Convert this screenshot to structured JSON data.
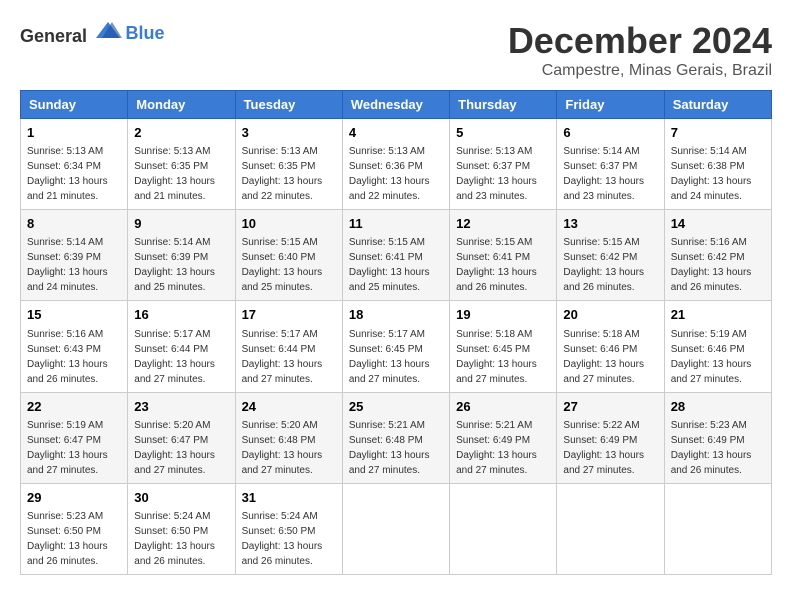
{
  "header": {
    "logo_general": "General",
    "logo_blue": "Blue",
    "month_title": "December 2024",
    "location": "Campestre, Minas Gerais, Brazil"
  },
  "calendar": {
    "days_of_week": [
      "Sunday",
      "Monday",
      "Tuesday",
      "Wednesday",
      "Thursday",
      "Friday",
      "Saturday"
    ],
    "weeks": [
      [
        {
          "day": "1",
          "sunrise": "5:13 AM",
          "sunset": "6:34 PM",
          "daylight": "13 hours and 21 minutes."
        },
        {
          "day": "2",
          "sunrise": "5:13 AM",
          "sunset": "6:35 PM",
          "daylight": "13 hours and 21 minutes."
        },
        {
          "day": "3",
          "sunrise": "5:13 AM",
          "sunset": "6:35 PM",
          "daylight": "13 hours and 22 minutes."
        },
        {
          "day": "4",
          "sunrise": "5:13 AM",
          "sunset": "6:36 PM",
          "daylight": "13 hours and 22 minutes."
        },
        {
          "day": "5",
          "sunrise": "5:13 AM",
          "sunset": "6:37 PM",
          "daylight": "13 hours and 23 minutes."
        },
        {
          "day": "6",
          "sunrise": "5:14 AM",
          "sunset": "6:37 PM",
          "daylight": "13 hours and 23 minutes."
        },
        {
          "day": "7",
          "sunrise": "5:14 AM",
          "sunset": "6:38 PM",
          "daylight": "13 hours and 24 minutes."
        }
      ],
      [
        {
          "day": "8",
          "sunrise": "5:14 AM",
          "sunset": "6:39 PM",
          "daylight": "13 hours and 24 minutes."
        },
        {
          "day": "9",
          "sunrise": "5:14 AM",
          "sunset": "6:39 PM",
          "daylight": "13 hours and 25 minutes."
        },
        {
          "day": "10",
          "sunrise": "5:15 AM",
          "sunset": "6:40 PM",
          "daylight": "13 hours and 25 minutes."
        },
        {
          "day": "11",
          "sunrise": "5:15 AM",
          "sunset": "6:41 PM",
          "daylight": "13 hours and 25 minutes."
        },
        {
          "day": "12",
          "sunrise": "5:15 AM",
          "sunset": "6:41 PM",
          "daylight": "13 hours and 26 minutes."
        },
        {
          "day": "13",
          "sunrise": "5:15 AM",
          "sunset": "6:42 PM",
          "daylight": "13 hours and 26 minutes."
        },
        {
          "day": "14",
          "sunrise": "5:16 AM",
          "sunset": "6:42 PM",
          "daylight": "13 hours and 26 minutes."
        }
      ],
      [
        {
          "day": "15",
          "sunrise": "5:16 AM",
          "sunset": "6:43 PM",
          "daylight": "13 hours and 26 minutes."
        },
        {
          "day": "16",
          "sunrise": "5:17 AM",
          "sunset": "6:44 PM",
          "daylight": "13 hours and 27 minutes."
        },
        {
          "day": "17",
          "sunrise": "5:17 AM",
          "sunset": "6:44 PM",
          "daylight": "13 hours and 27 minutes."
        },
        {
          "day": "18",
          "sunrise": "5:17 AM",
          "sunset": "6:45 PM",
          "daylight": "13 hours and 27 minutes."
        },
        {
          "day": "19",
          "sunrise": "5:18 AM",
          "sunset": "6:45 PM",
          "daylight": "13 hours and 27 minutes."
        },
        {
          "day": "20",
          "sunrise": "5:18 AM",
          "sunset": "6:46 PM",
          "daylight": "13 hours and 27 minutes."
        },
        {
          "day": "21",
          "sunrise": "5:19 AM",
          "sunset": "6:46 PM",
          "daylight": "13 hours and 27 minutes."
        }
      ],
      [
        {
          "day": "22",
          "sunrise": "5:19 AM",
          "sunset": "6:47 PM",
          "daylight": "13 hours and 27 minutes."
        },
        {
          "day": "23",
          "sunrise": "5:20 AM",
          "sunset": "6:47 PM",
          "daylight": "13 hours and 27 minutes."
        },
        {
          "day": "24",
          "sunrise": "5:20 AM",
          "sunset": "6:48 PM",
          "daylight": "13 hours and 27 minutes."
        },
        {
          "day": "25",
          "sunrise": "5:21 AM",
          "sunset": "6:48 PM",
          "daylight": "13 hours and 27 minutes."
        },
        {
          "day": "26",
          "sunrise": "5:21 AM",
          "sunset": "6:49 PM",
          "daylight": "13 hours and 27 minutes."
        },
        {
          "day": "27",
          "sunrise": "5:22 AM",
          "sunset": "6:49 PM",
          "daylight": "13 hours and 27 minutes."
        },
        {
          "day": "28",
          "sunrise": "5:23 AM",
          "sunset": "6:49 PM",
          "daylight": "13 hours and 26 minutes."
        }
      ],
      [
        {
          "day": "29",
          "sunrise": "5:23 AM",
          "sunset": "6:50 PM",
          "daylight": "13 hours and 26 minutes."
        },
        {
          "day": "30",
          "sunrise": "5:24 AM",
          "sunset": "6:50 PM",
          "daylight": "13 hours and 26 minutes."
        },
        {
          "day": "31",
          "sunrise": "5:24 AM",
          "sunset": "6:50 PM",
          "daylight": "13 hours and 26 minutes."
        },
        null,
        null,
        null,
        null
      ]
    ]
  }
}
